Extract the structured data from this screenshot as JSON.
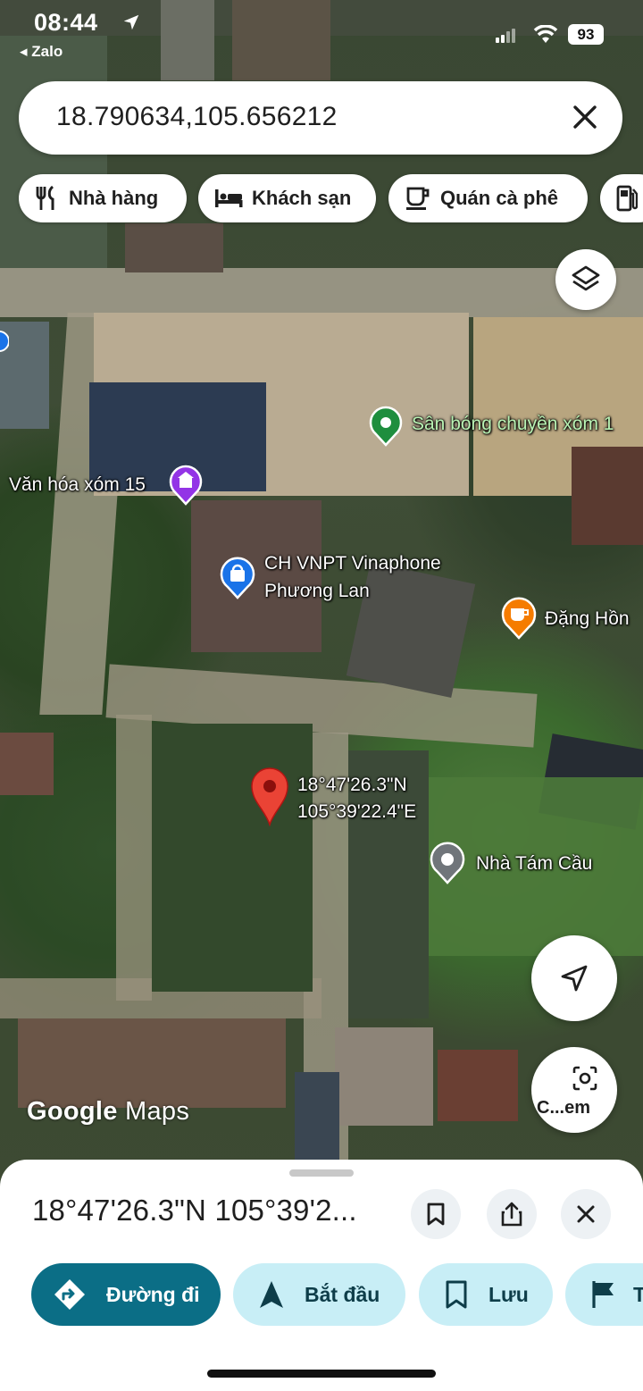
{
  "status_bar": {
    "time": "08:44",
    "back_app": "◂ Zalo",
    "battery": "93"
  },
  "search": {
    "query": "18.790634,105.656212"
  },
  "chips": [
    {
      "label": "Nhà hàng",
      "icon": "restaurant-icon"
    },
    {
      "label": "Khách sạn",
      "icon": "hotel-icon"
    },
    {
      "label": "Quán cà phê",
      "icon": "coffee-icon"
    },
    {
      "label": "",
      "icon": "gas-station-icon"
    }
  ],
  "map": {
    "places": [
      {
        "name": "Sân bóng chuyền xóm 1",
        "icon": "green-place-pin",
        "color": "#1e8e3e"
      },
      {
        "name": "Văn hóa xóm 15",
        "icon": "purple-place-pin",
        "color": "#9334e6"
      },
      {
        "name": "CH VNPT Vinaphone",
        "name_line2": "Phương Lan",
        "icon": "blue-shop-pin",
        "color": "#1a73e8"
      },
      {
        "name": "Đặng Hồn",
        "icon": "orange-cafe-pin",
        "color": "#f57c00"
      },
      {
        "name": "Nhà Tám Cầu",
        "icon": "gray-place-pin",
        "color": "#70757a"
      }
    ],
    "dropped_pin": {
      "lat_dms": "18°47'26.3\"N",
      "lng_dms": "105°39'22.4\"E",
      "color": "#ea4335"
    },
    "attribution": {
      "google": "Google",
      "maps": "Maps"
    },
    "lens_label": "C...em"
  },
  "sheet": {
    "title": "18°47'26.3\"N 105°39'2...",
    "actions": [
      {
        "label": "Đường đi",
        "icon": "directions-icon"
      },
      {
        "label": "Bắt đầu",
        "icon": "navigation-arrow-icon"
      },
      {
        "label": "Lưu",
        "icon": "bookmark-icon"
      },
      {
        "label": "T",
        "icon": "flag-icon"
      }
    ]
  },
  "colors": {
    "primary_action": "#0b6e86",
    "secondary_action": "#c8eef6",
    "accent_pin": "#ea4335"
  }
}
